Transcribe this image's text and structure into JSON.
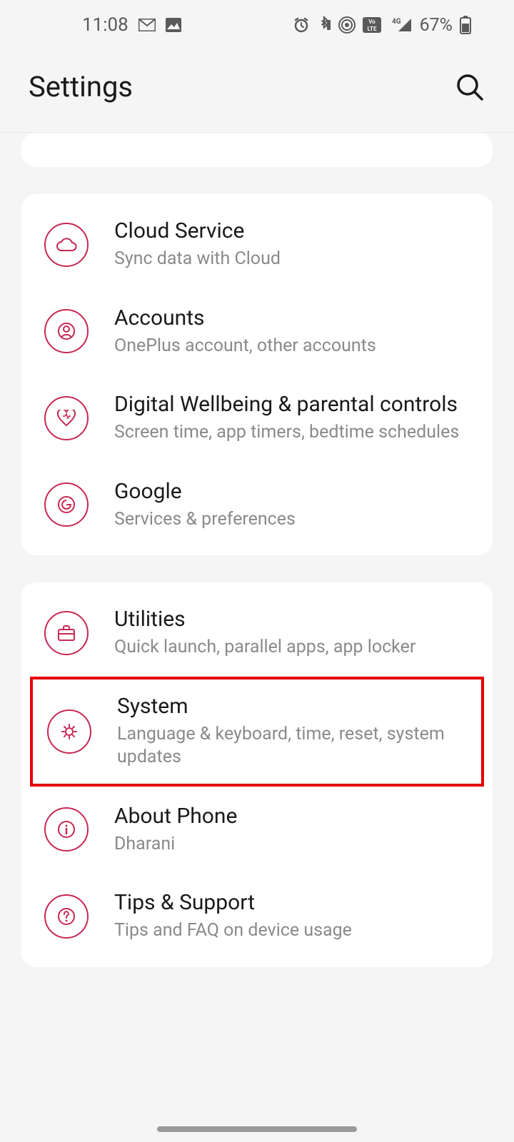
{
  "status": {
    "time": "11:08",
    "battery_text": "67%"
  },
  "header": {
    "title": "Settings"
  },
  "group1": {
    "items": [
      {
        "title": "Cloud Service",
        "subtitle": "Sync data with Cloud"
      },
      {
        "title": "Accounts",
        "subtitle": "OnePlus account, other accounts"
      },
      {
        "title": "Digital Wellbeing & parental controls",
        "subtitle": "Screen time, app timers, bedtime schedules"
      },
      {
        "title": "Google",
        "subtitle": "Services & preferences"
      }
    ]
  },
  "group2": {
    "items": [
      {
        "title": "Utilities",
        "subtitle": "Quick launch, parallel apps, app locker"
      },
      {
        "title": "System",
        "subtitle": "Language & keyboard, time, reset, system updates"
      },
      {
        "title": "About Phone",
        "subtitle": "Dharani"
      },
      {
        "title": "Tips & Support",
        "subtitle": "Tips and FAQ on device usage"
      }
    ]
  }
}
